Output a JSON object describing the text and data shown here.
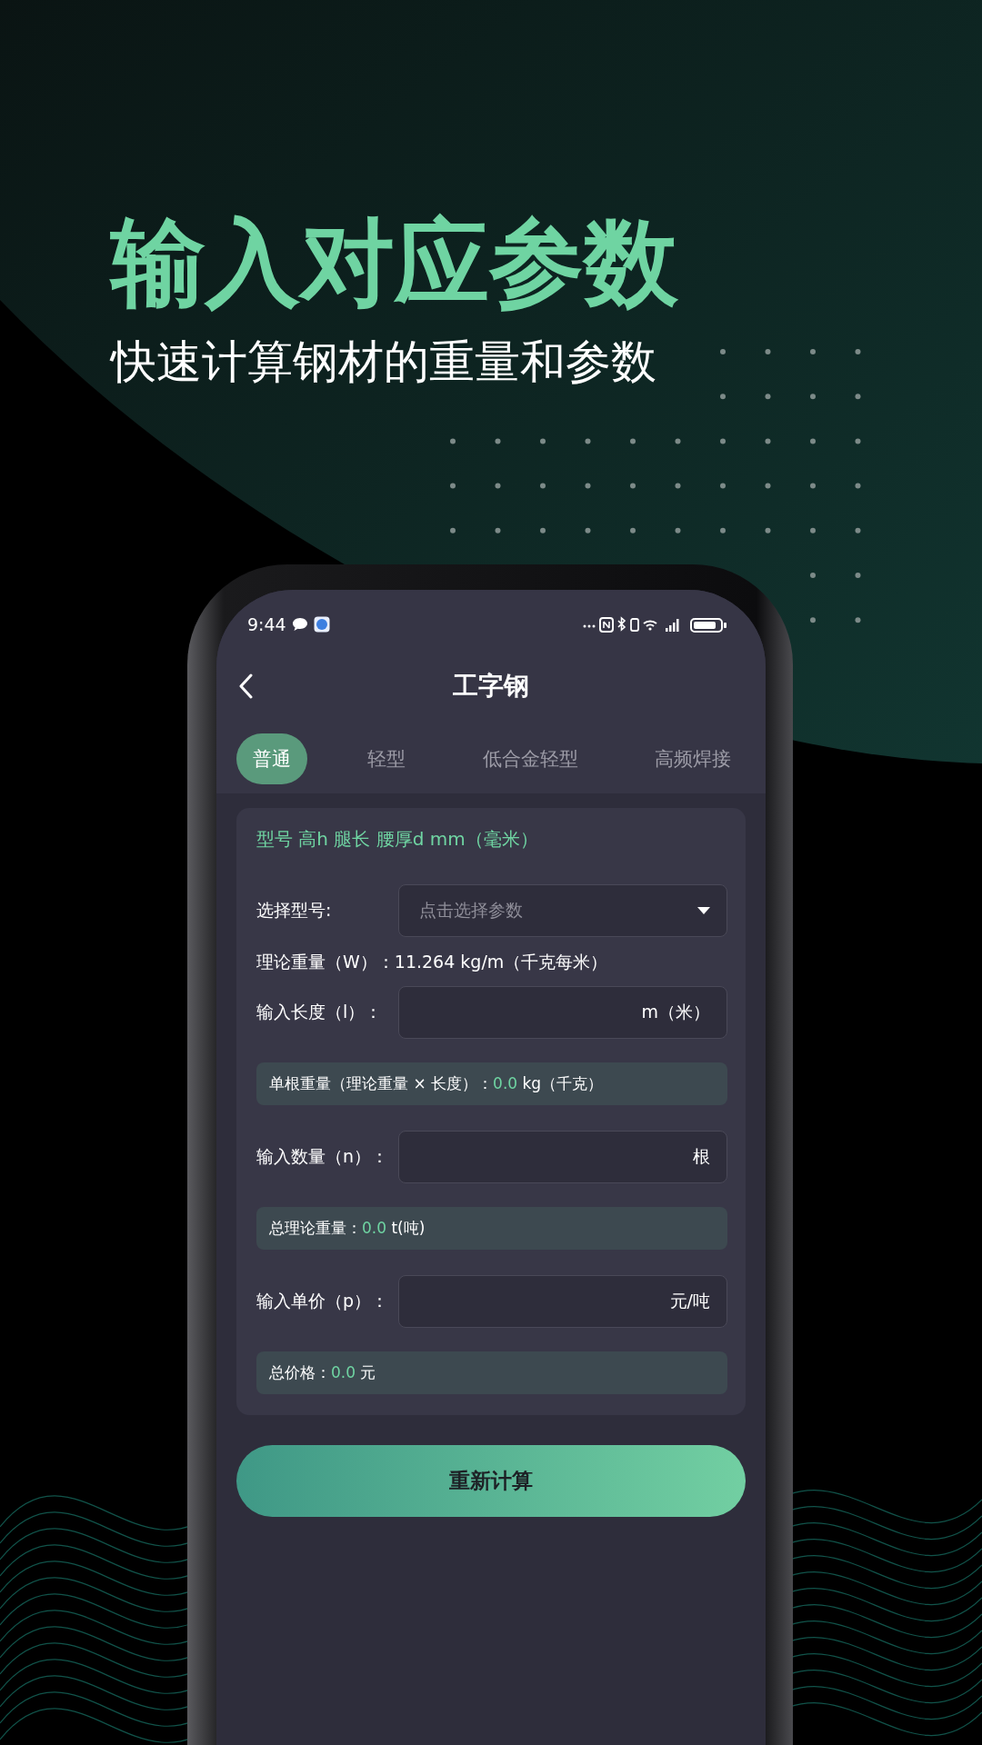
{
  "headline": "输入对应参数",
  "subheadline": "快速计算钢材的重量和参数",
  "status_bar": {
    "time": "9:44"
  },
  "nav": {
    "title": "工字钢"
  },
  "tabs": [
    {
      "label": "普通",
      "selected": true
    },
    {
      "label": "轻型",
      "selected": false
    },
    {
      "label": "低合金轻型",
      "selected": false
    },
    {
      "label": "高频焊接",
      "selected": false
    }
  ],
  "card": {
    "header": "型号 高h 腿长 腰厚d mm（毫米）",
    "rows": [
      {
        "kind": "select",
        "label": "选择型号:",
        "placeholder": "点击选择参数"
      },
      {
        "kind": "info",
        "label": "理论重量（W）：",
        "value": "11.264 kg/m（千克每米）"
      },
      {
        "kind": "input",
        "label": "输入长度（l）：",
        "unit": "m（米）"
      },
      {
        "kind": "result",
        "label": "单根重量（理论重量 × 长度）：",
        "value": "0.0",
        "unit": "kg（千克）"
      },
      {
        "kind": "input",
        "label": "输入数量（n）：",
        "unit": "根"
      },
      {
        "kind": "result",
        "label": "总理论重量：",
        "value": "0.0",
        "unit": "t(吨)"
      },
      {
        "kind": "input",
        "label": "输入单价（p）：",
        "unit": "元/吨"
      },
      {
        "kind": "result",
        "label": "总价格：",
        "value": "0.0",
        "unit": "元"
      }
    ]
  },
  "button": "重新计算"
}
